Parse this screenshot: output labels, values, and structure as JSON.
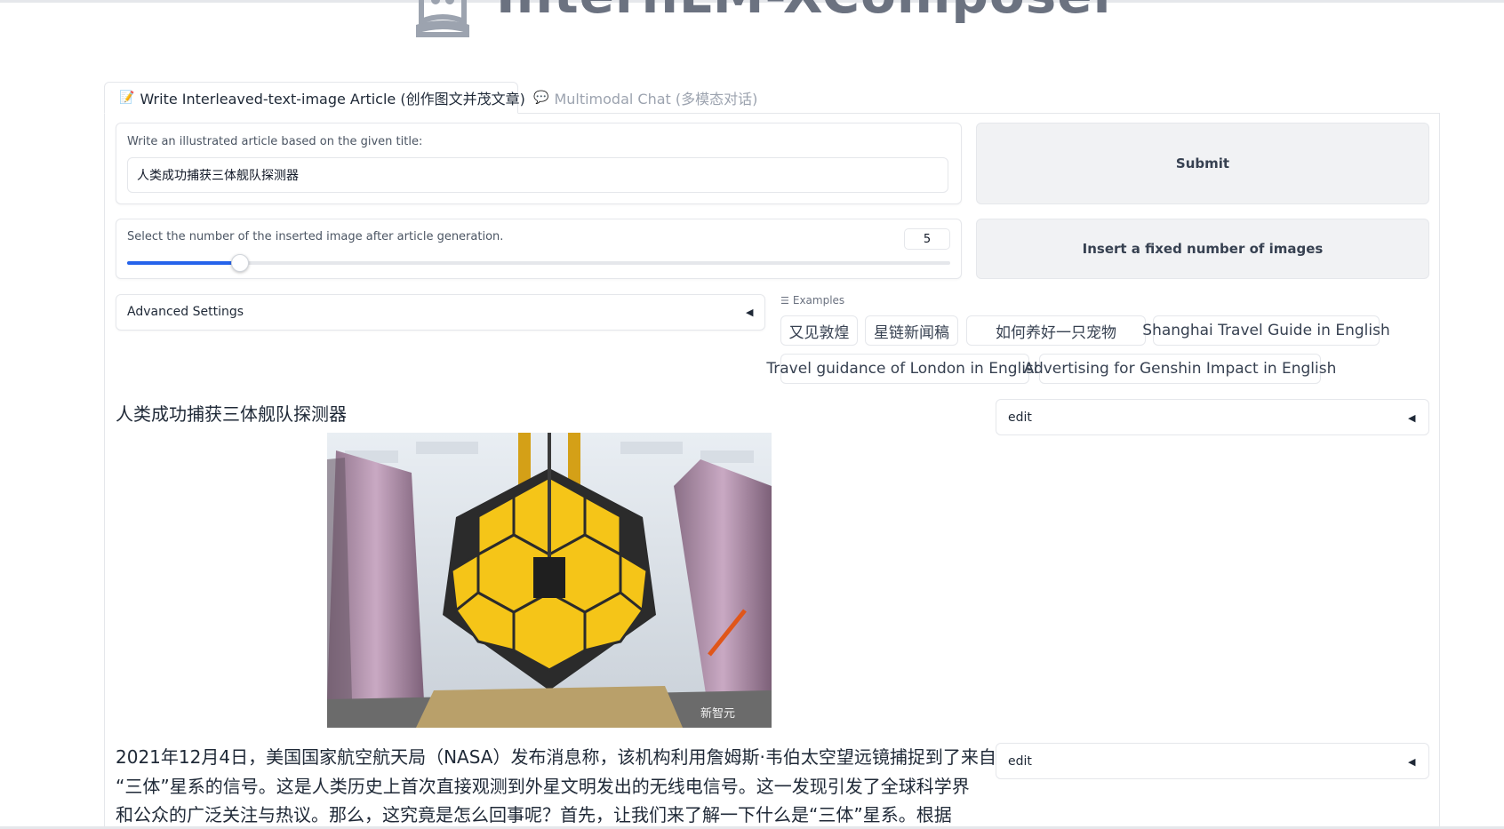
{
  "header": {
    "app_title": "InternLM-XComposer"
  },
  "tabs": [
    {
      "icon": "memo-icon",
      "label": "Write Interleaved-text-image Article (创作图文并茂文章)",
      "active": true
    },
    {
      "icon": "speech-bubble-icon",
      "label": "Multimodal Chat (多模态对话)",
      "active": false
    }
  ],
  "form": {
    "title_label": "Write an illustrated article based on the given title:",
    "title_value": "人类成功捕获三体舰队探测器",
    "submit_label": "Submit",
    "slider_label": "Select the number of the inserted image after article generation.",
    "slider_value": "5",
    "slider_fraction": 0.137,
    "insert_label": "Insert a fixed number of images",
    "advanced_label": "Advanced Settings"
  },
  "examples": {
    "label": "Examples",
    "items": [
      "又见敦煌",
      "星链新闻稿",
      "如何养好一只宠物",
      "Shanghai Travel Guide in English",
      "Travel guidance of London in English",
      "Advertising for Genshin Impact in English"
    ]
  },
  "article": {
    "title": "人类成功捕获三体舰队探测器",
    "image_watermark": "新智元",
    "edit_label": "edit",
    "paragraph_lines": [
      "2021年12月4日，美国国家航空航天局（NASA）发布消息称，该机构利用詹姆斯·韦伯太空望远镜捕捉到了来自",
      "“三体”星系的信号。这是人类历史上首次直接观测到外星文明发出的无线电信号。这一发现引发了全球科学界",
      "和公众的广泛关注与热议。那么，这究竟是怎么回事呢？首先，让我们来了解一下什么是“三体”星系。根据"
    ]
  },
  "colors": {
    "accent": "#2563eb",
    "button_bg": "#f1f2f4",
    "mirror_gold": "#f5c518"
  }
}
